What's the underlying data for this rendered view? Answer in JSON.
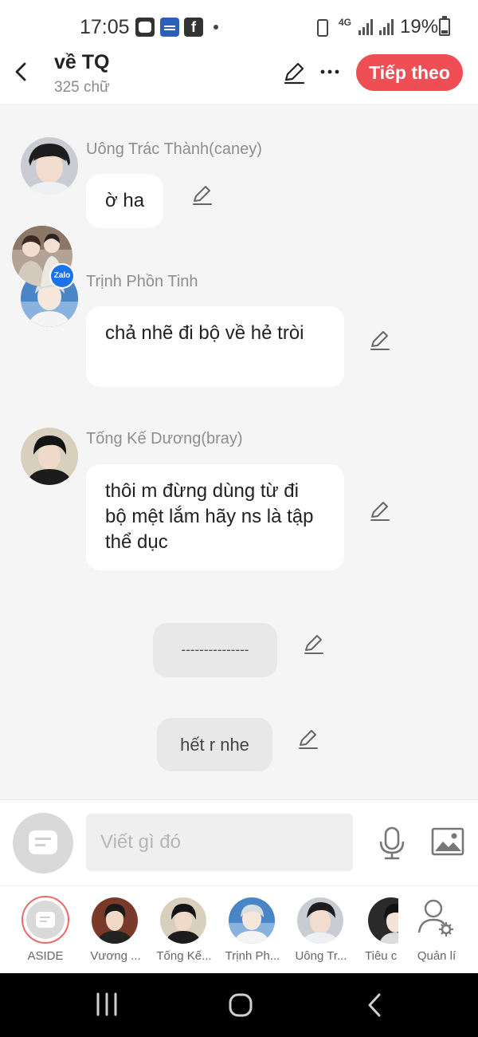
{
  "status_bar": {
    "time": "17:05",
    "network": "4G",
    "battery_percent": "19%",
    "notification_icons": [
      "video-icon",
      "document-icon",
      "facebook-icon"
    ],
    "facebook_glyph": "f"
  },
  "header": {
    "title": "về TQ",
    "word_count": "325 chữ",
    "next_button": "Tiếp theo",
    "accent_color": "#f04e55"
  },
  "messages": [
    {
      "sender": "Uông Trác Thành(caney)",
      "text": "ờ ha"
    },
    {
      "sender": "Trịnh Phồn Tinh",
      "text": "chả nhẽ đi bộ về hẻ tròi"
    },
    {
      "sender": "Tống Kế Dương(bray)",
      "text": "thôi m đừng dùng từ đi bộ mệt lắm hãy ns là tập thể dục"
    },
    {
      "sender": "",
      "text": "---------------"
    },
    {
      "sender": "",
      "text": "hết r nhe"
    }
  ],
  "zalo_badge": "Zalo",
  "composer": {
    "placeholder": "Viết gì đó"
  },
  "characters": [
    {
      "label": "ASIDE"
    },
    {
      "label": "Vương ..."
    },
    {
      "label": "Tống Kế..."
    },
    {
      "label": "Trịnh Ph..."
    },
    {
      "label": "Uông Tr..."
    },
    {
      "label": "Tiêu c"
    },
    {
      "label": "Quản lí"
    }
  ]
}
